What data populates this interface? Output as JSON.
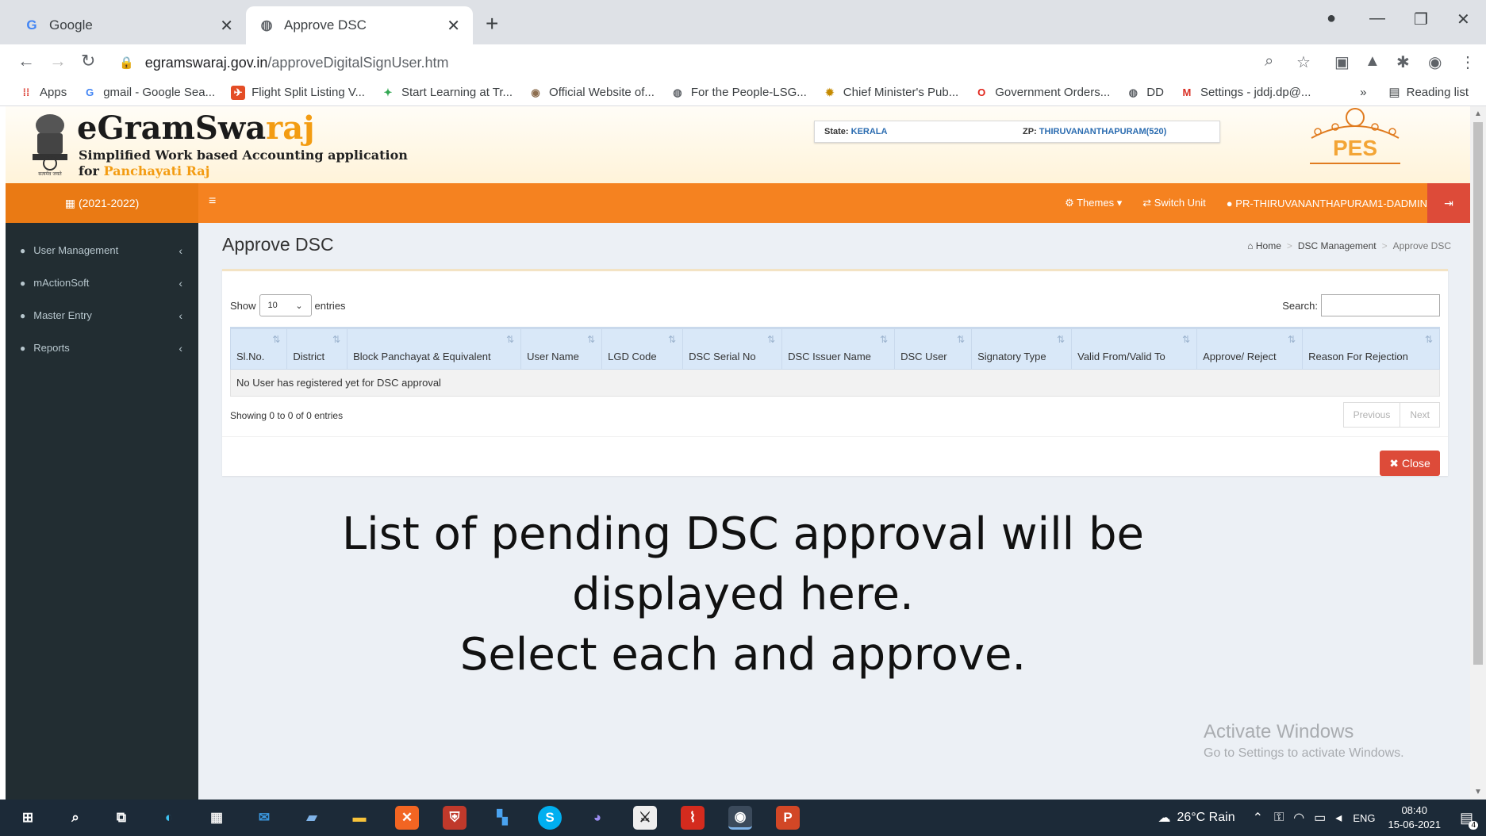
{
  "browser": {
    "tabs": [
      {
        "title": "Google",
        "favicon": "google-g-icon"
      },
      {
        "title": "Approve DSC",
        "favicon": "globe-icon"
      }
    ],
    "url_host": "egramswaraj.gov.in",
    "url_path": "/approveDigitalSignUser.htm",
    "bookmarks": [
      {
        "label": "Apps",
        "icon": "apps-grid-icon"
      },
      {
        "label": "gmail - Google Sea...",
        "icon": "google-g-icon"
      },
      {
        "label": "Flight Split Listing V...",
        "icon": "flight-icon"
      },
      {
        "label": "Start Learning at Tr...",
        "icon": "learning-icon"
      },
      {
        "label": "Official Website of...",
        "icon": "emblem-icon"
      },
      {
        "label": "For the People-LSG...",
        "icon": "globe-icon"
      },
      {
        "label": "Chief Minister's Pub...",
        "icon": "cm-icon"
      },
      {
        "label": "Government Orders...",
        "icon": "opera-icon"
      },
      {
        "label": "DD",
        "icon": "globe-icon"
      },
      {
        "label": "Settings - jddj.dp@...",
        "icon": "gmail-icon"
      }
    ],
    "more": "»",
    "reading_list": "Reading list"
  },
  "app": {
    "brand_prefix": "eGramSwa",
    "brand_suffix": "raj",
    "tagline1": "Simplified Work based Accounting application",
    "tagline2_prefix": "for ",
    "tagline2_accent": "Panchayati Raj",
    "emblem_caption": "सत्यमेव जयते",
    "state_label": "State:",
    "state_value": "KERALA",
    "zp_label": "ZP:",
    "zp_value": "THIRUVANANTHAPURAM(520)",
    "pes_label": "PES"
  },
  "navbar": {
    "fiscal_year": "(2021-2022)",
    "themes": "Themes",
    "switch_unit": "Switch Unit",
    "user": "PR-THIRUVANANTHAPURAM1-DADMIN"
  },
  "sidebar": {
    "items": [
      {
        "label": "User Management"
      },
      {
        "label": "mActionSoft"
      },
      {
        "label": "Master Entry"
      },
      {
        "label": "Reports"
      }
    ]
  },
  "page": {
    "title": "Approve DSC",
    "breadcrumb": [
      "Home",
      "DSC Management",
      "Approve DSC"
    ],
    "show_label": "Show",
    "entries_value": "10",
    "entries_label": "entries",
    "search_label": "Search:",
    "columns": [
      "Sl.No.",
      "District",
      "Block Panchayat & Equivalent",
      "User Name",
      "LGD Code",
      "DSC Serial No",
      "DSC Issuer Name",
      "DSC User",
      "Signatory Type",
      "Valid From/Valid To",
      "Approve/ Reject",
      "Reason For Rejection"
    ],
    "empty_message": "No User has registered yet for DSC approval",
    "showing": "Showing 0 to 0 of 0 entries",
    "prev": "Previous",
    "next": "Next",
    "close": "Close"
  },
  "caption": {
    "line1": "List of pending DSC approval will be",
    "line2": "displayed here.",
    "line3": "Select each and approve."
  },
  "watermark": {
    "line1": "Activate Windows",
    "line2": "Go to Settings to activate Windows."
  },
  "taskbar": {
    "weather": "26°C  Rain",
    "lang": "ENG",
    "time": "08:40",
    "date": "15-06-2021",
    "notifications": "4"
  }
}
